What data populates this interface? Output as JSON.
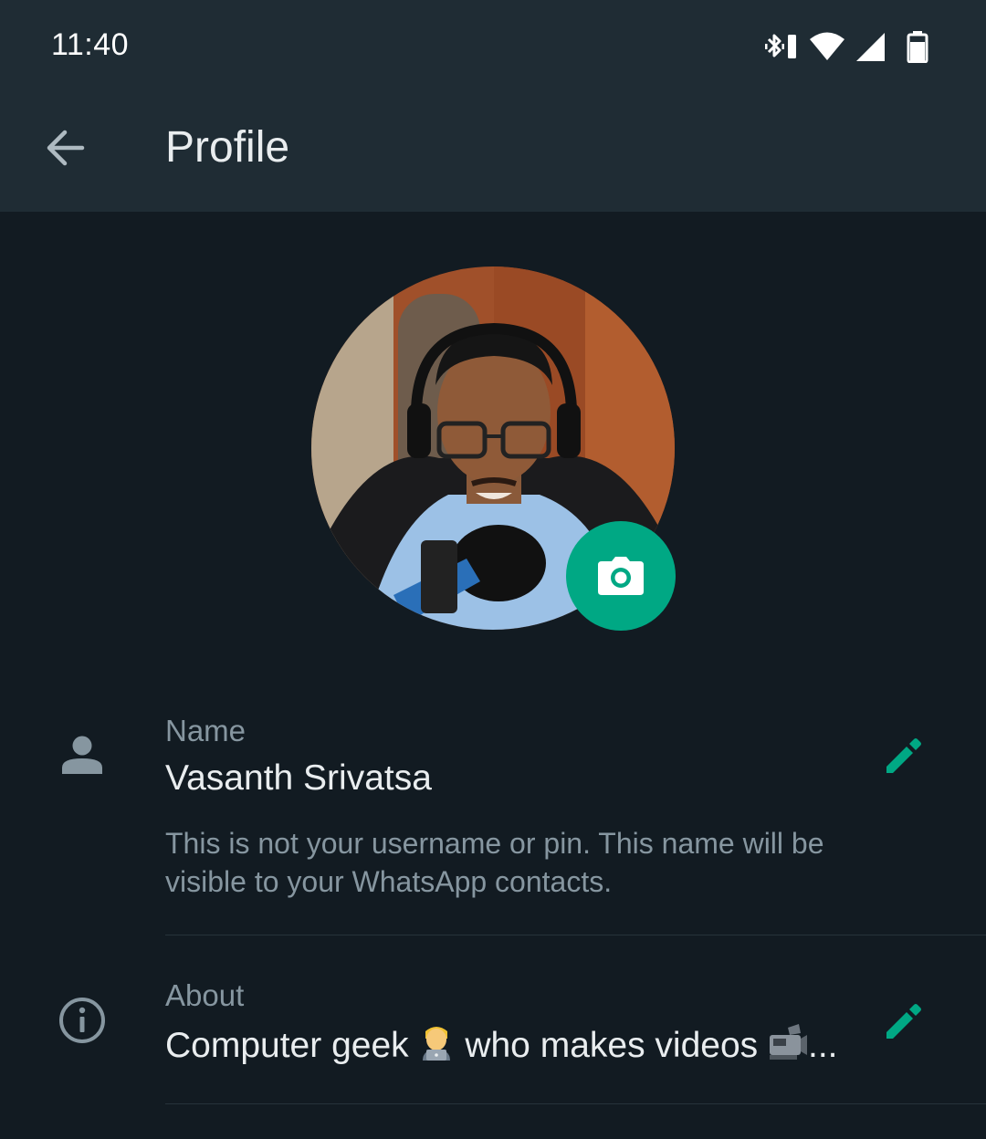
{
  "status_bar": {
    "time": "11:40",
    "icons": [
      "bluetooth-vibrate-icon",
      "wifi-icon",
      "cell-signal-icon",
      "battery-icon"
    ]
  },
  "header": {
    "back_icon": "arrow-left-icon",
    "title": "Profile"
  },
  "profile": {
    "avatar": "profile-photo",
    "camera_icon": "camera-icon"
  },
  "name_section": {
    "icon": "person-icon",
    "label": "Name",
    "value": "Vasanth Srivatsa",
    "helper": "This is not your username or pin. This name will be visible to your WhatsApp contacts.",
    "edit_icon": "pencil-icon"
  },
  "about_section": {
    "icon": "info-icon",
    "label": "About",
    "value_part1": "Computer geek",
    "value_part2": "who makes videos",
    "ellipsis": "...",
    "emoji1": "technologist-emoji",
    "emoji2": "video-camera-emoji",
    "edit_icon": "pencil-icon"
  },
  "colors": {
    "accent": "#00a884",
    "header_bg": "#1f2c34",
    "page_bg": "#121b22",
    "secondary_text": "#8696a0"
  }
}
